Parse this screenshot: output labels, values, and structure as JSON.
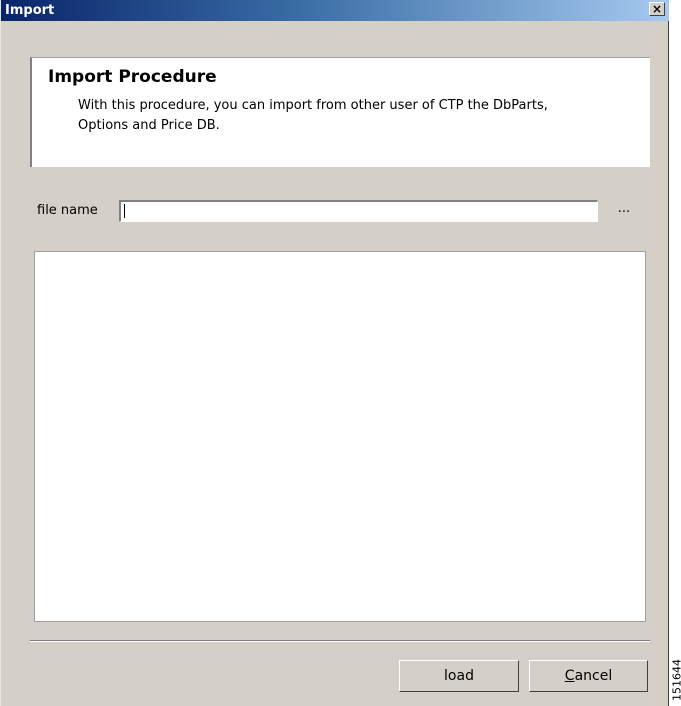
{
  "window": {
    "title": "Import",
    "close_glyph": "×",
    "close_icon": "close-icon"
  },
  "header": {
    "title": "Import Procedure",
    "description": "With this procedure, you can import from other user of CTP the DbParts, Options and Price DB."
  },
  "file": {
    "label": "file name",
    "value": "",
    "browse_label": "..."
  },
  "buttons": {
    "load_label": "load",
    "cancel_label_mnemonic": "C",
    "cancel_label_rest": "ancel"
  },
  "figure_number": "151644",
  "colors": {
    "titlebar_start": "#0a246a",
    "titlebar_end": "#a6caf0",
    "dialog_background": "#d4d0c8"
  }
}
